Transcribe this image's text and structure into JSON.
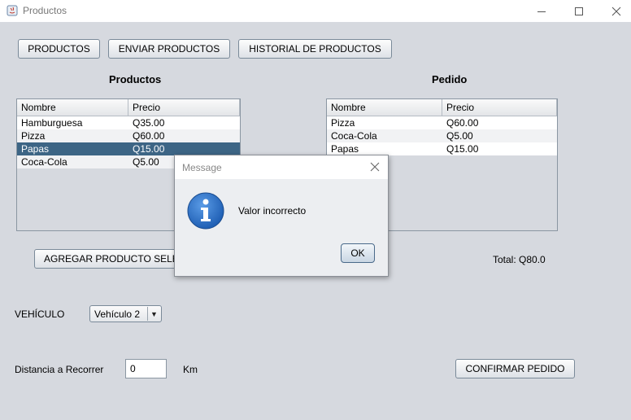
{
  "window": {
    "title": "Productos"
  },
  "toolbar": {
    "productos": "PRODUCTOS",
    "enviar": "ENVIAR PRODUCTOS",
    "historial": "HISTORIAL DE PRODUCTOS"
  },
  "productos": {
    "title": "Productos",
    "columns": [
      "Nombre",
      "Precio"
    ],
    "rows": [
      {
        "nombre": "Hamburguesa",
        "precio": "Q35.00"
      },
      {
        "nombre": "Pizza",
        "precio": "Q60.00"
      },
      {
        "nombre": "Papas",
        "precio": "Q15.00"
      },
      {
        "nombre": "Coca-Cola",
        "precio": "Q5.00"
      }
    ],
    "selected_row": 2,
    "add_button": "AGREGAR PRODUCTO SELE"
  },
  "pedido": {
    "title": "Pedido",
    "columns": [
      "Nombre",
      "Precio"
    ],
    "rows": [
      {
        "nombre": "Pizza",
        "precio": "Q60.00"
      },
      {
        "nombre": "Coca-Cola",
        "precio": "Q5.00"
      },
      {
        "nombre": "Papas",
        "precio": "Q15.00"
      }
    ],
    "total": "Total: Q80.0"
  },
  "vehiculo": {
    "label": "VEHÍCULO",
    "selected": "Vehículo 2"
  },
  "distancia": {
    "label": "Distancia a Recorrer",
    "value": "0",
    "unit": "Km"
  },
  "confirm_button": "CONFIRMAR PEDIDO",
  "dialog": {
    "title": "Message",
    "message": "Valor incorrecto",
    "ok": "OK"
  },
  "colors": {
    "selection": "#3d6585",
    "info_icon": "#1f5fb4"
  }
}
